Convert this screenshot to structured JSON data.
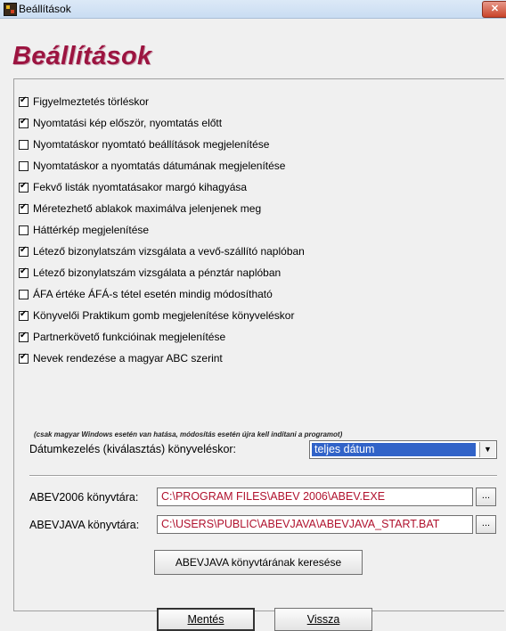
{
  "window": {
    "title": "Beállítások",
    "close_label": "✕"
  },
  "heading": "Beállítások",
  "options": [
    {
      "label": "Figyelmeztetés törléskor",
      "checked": true
    },
    {
      "label": "Nyomtatási kép először, nyomtatás előtt",
      "checked": true
    },
    {
      "label": "Nyomtatáskor nyomtató beállítások megjelenítése",
      "checked": false
    },
    {
      "label": "Nyomtatáskor a nyomtatás dátumának megjelenítése",
      "checked": false
    },
    {
      "label": "Fekvő listák nyomtatásakor margó kihagyása",
      "checked": true
    },
    {
      "label": "Méretezhető ablakok maximálva jelenjenek meg",
      "checked": true
    },
    {
      "label": "Háttérkép megjelenítése",
      "checked": false
    },
    {
      "label": "Létező bizonylatszám vizsgálata a vevő-szállító naplóban",
      "checked": true
    },
    {
      "label": "Létező bizonylatszám vizsgálata a pénztár naplóban",
      "checked": true
    },
    {
      "label": "ÁFA értéke ÁFÁ-s tétel esetén mindig módosítható",
      "checked": false
    },
    {
      "label": "Könyvelői Praktikum gomb megjelenítése könyveléskor",
      "checked": true
    },
    {
      "label": "Partnerkövető funkcióinak megjelenítése",
      "checked": true
    },
    {
      "label": "Nevek rendezése a magyar ABC szerint",
      "checked": true
    }
  ],
  "abc_note": "(csak magyar Windows esetén van hatása, módosítás esetén újra kell indítani a programot)",
  "date_handling": {
    "label": "Dátumkezelés (kiválasztás) könyveléskor:",
    "value": "teljes dátum"
  },
  "abev2006": {
    "label": "ABEV2006 könyvtára:",
    "value": "C:\\PROGRAM FILES\\ABEV 2006\\ABEV.EXE",
    "browse": "..."
  },
  "abevjava": {
    "label": "ABEVJAVA könyvtára:",
    "value": "C:\\USERS\\PUBLIC\\ABEVJAVA\\ABEVJAVA_START.BAT",
    "browse": "..."
  },
  "search_button": "ABEVJAVA könyvtárának keresése",
  "save_button": "Mentés",
  "back_button": "Vissza"
}
